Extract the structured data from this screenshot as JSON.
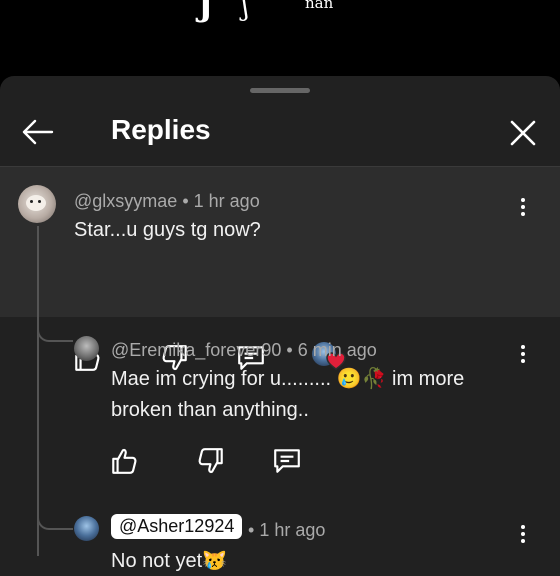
{
  "background": {
    "glyph1": "J",
    "glyph2": "ʃ",
    "text": "nan"
  },
  "header": {
    "title": "Replies",
    "back_icon": "arrow-left-icon",
    "close_icon": "close-icon"
  },
  "parent_comment": {
    "username": "@glxsyymae",
    "separator": "•",
    "time": "1 hr ago",
    "text": "Star...u guys tg now?"
  },
  "replies": [
    {
      "username": "@Eremika_forever90",
      "separator": "•",
      "time": "6 min ago",
      "text_line1": "Mae im crying for u.........",
      "emoji": "🥲🥀",
      "text_line1_end": "im more",
      "text_line2": "broken than anything.."
    },
    {
      "username": "@Asher12924",
      "separator": "•",
      "time": "1 hr ago",
      "text": "No not yet",
      "emoji": "😿"
    }
  ],
  "colors": {
    "sheet": "#212121",
    "parent_highlight": "#2d2d2d",
    "heart": "#e0203a"
  }
}
